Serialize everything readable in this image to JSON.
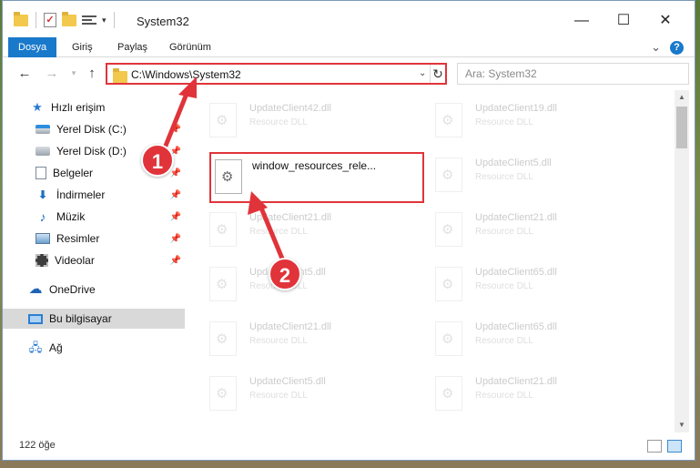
{
  "window": {
    "title": "System32",
    "minimize_glyph": "—",
    "maximize_glyph": "☐",
    "close_glyph": "✕"
  },
  "qat": {
    "dropdown_glyph": "▾"
  },
  "ribbon": {
    "tabs": [
      {
        "label": "Dosya",
        "active": true
      },
      {
        "label": "Giriş"
      },
      {
        "label": "Paylaş"
      },
      {
        "label": "Görünüm"
      }
    ],
    "expand_glyph": "⌄",
    "help_glyph": "?"
  },
  "nav": {
    "back_glyph": "←",
    "forward_glyph": "→",
    "up_glyph": "↑",
    "address_path": "C:\\Windows\\System32",
    "address_dropdown_glyph": "⌄",
    "refresh_glyph": "↻",
    "search_placeholder": "Ara: System32"
  },
  "sidebar": {
    "items": [
      {
        "label": "Hızlı erişim",
        "icon": "quick-access-icon"
      },
      {
        "label": "Yerel Disk (C:)",
        "icon": "local-disk-c-icon",
        "pinned": true
      },
      {
        "label": "Yerel Disk (D:)",
        "icon": "local-disk-d-icon",
        "pinned": true
      },
      {
        "label": "Belgeler",
        "icon": "documents-icon",
        "pinned": true
      },
      {
        "label": "İndirmeler",
        "icon": "downloads-icon",
        "pinned": true
      },
      {
        "label": "Müzik",
        "icon": "music-icon",
        "pinned": true
      },
      {
        "label": "Resimler",
        "icon": "pictures-icon",
        "pinned": true
      },
      {
        "label": "Videolar",
        "icon": "videos-icon",
        "pinned": true
      },
      {
        "label": "OneDrive",
        "icon": "onedrive-icon"
      },
      {
        "label": "Bu bilgisayar",
        "icon": "this-pc-icon",
        "selected": true
      },
      {
        "label": "Ağ",
        "icon": "network-icon"
      }
    ],
    "pin_glyph": "📌"
  },
  "files": {
    "left": [
      {
        "name": "UpdateClient42.dll",
        "type": "Resource DLL"
      },
      {
        "name": "window_resources_rele...",
        "type": ""
      },
      {
        "name": "UpdateClient21.dll",
        "type": "Resource DLL"
      },
      {
        "name": "UpdateClient5.dll",
        "type": "Resource DLL"
      },
      {
        "name": "UpdateClient21.dll",
        "type": "Resource DLL"
      },
      {
        "name": "UpdateClient5.dll",
        "type": "Resource DLL"
      }
    ],
    "right": [
      {
        "name": "UpdateClient19.dll",
        "type": "Resource DLL"
      },
      {
        "name": "UpdateClient5.dll",
        "type": "Resource DLL"
      },
      {
        "name": "UpdateClient21.dll",
        "type": "Resource DLL"
      },
      {
        "name": "UpdateClient65.dll",
        "type": "Resource DLL"
      },
      {
        "name": "UpdateClient65.dll",
        "type": "Resource DLL"
      },
      {
        "name": "UpdateClient21.dll",
        "type": "Resource DLL"
      }
    ]
  },
  "scrollbar": {
    "up_glyph": "▲",
    "down_glyph": "▼"
  },
  "status": {
    "item_count": "122 öğe"
  },
  "annotations": {
    "step1": "1",
    "step2": "2",
    "color": "#e0343a"
  }
}
